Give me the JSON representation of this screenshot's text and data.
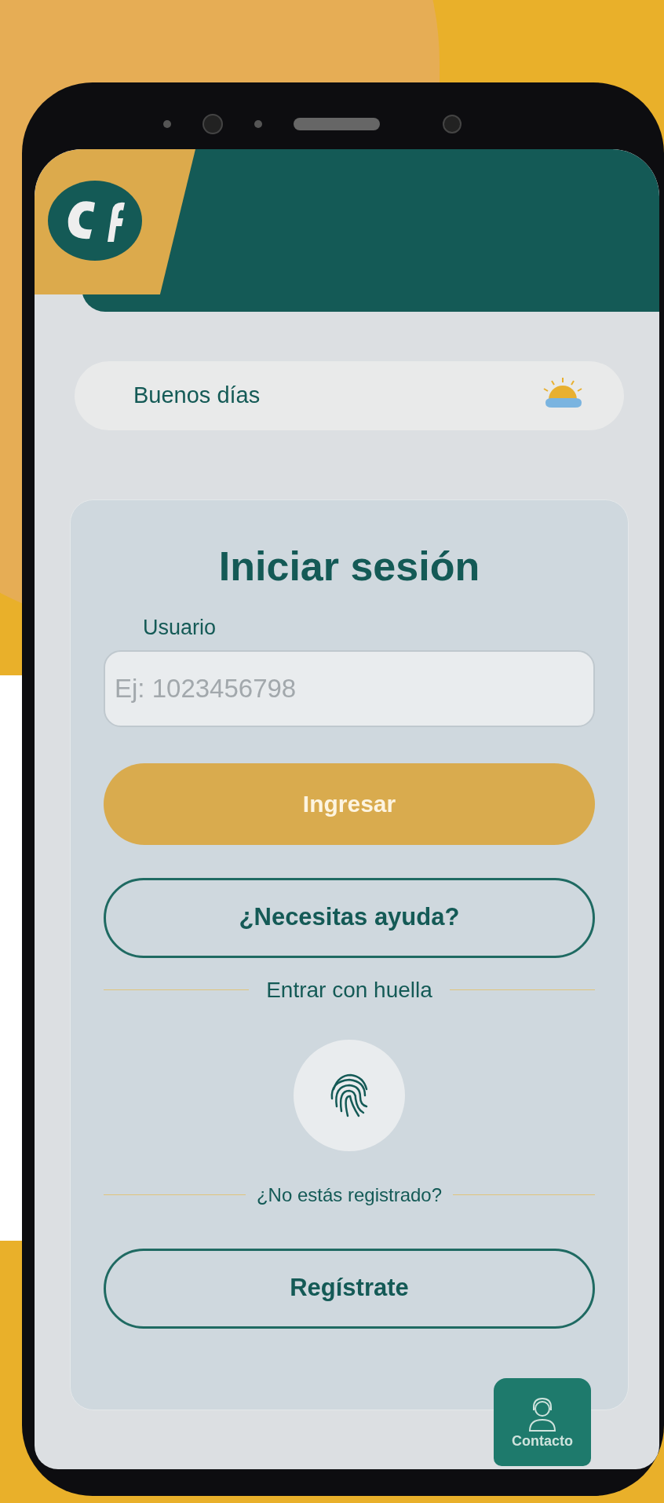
{
  "greeting": {
    "text": "Buenos días"
  },
  "login": {
    "title": "Iniciar sesión",
    "user_label": "Usuario",
    "user_placeholder": "Ej: 1023456798",
    "submit": "Ingresar",
    "help": "¿Necesitas ayuda?",
    "fingerprint_divider": "Entrar con huella",
    "register_divider": "¿No estás registrado?",
    "register": "Regístrate"
  },
  "contact_button": {
    "label": "Contacto"
  }
}
